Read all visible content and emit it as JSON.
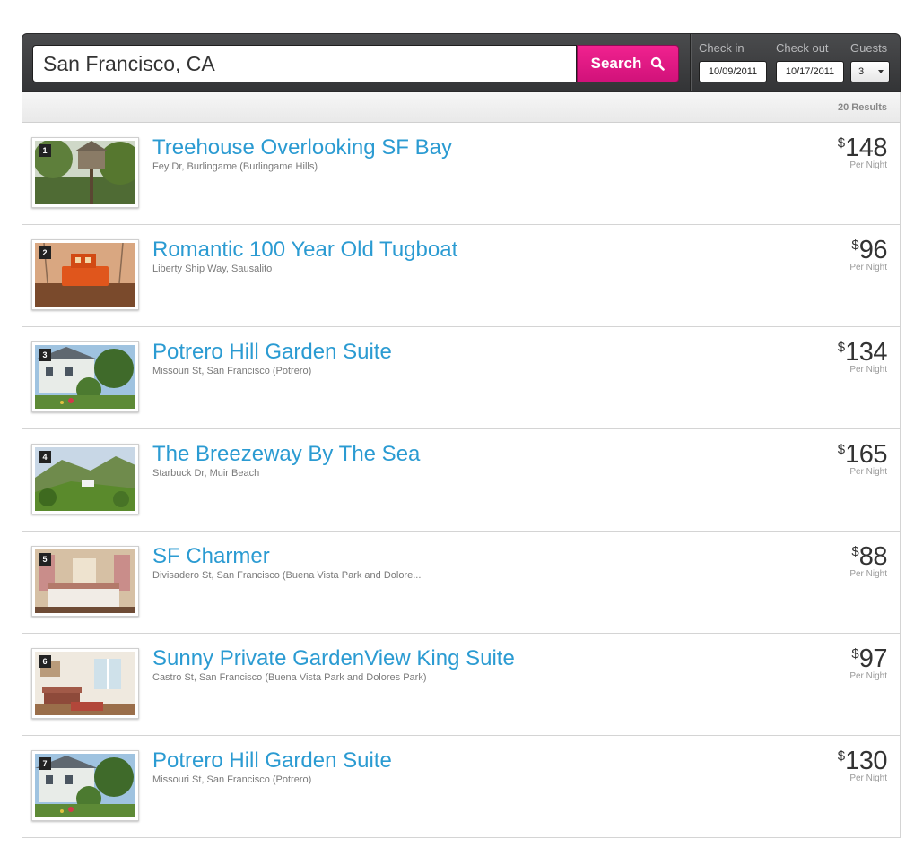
{
  "search": {
    "location_value": "San Francisco, CA",
    "button_label": "Search"
  },
  "dates": {
    "checkin_label": "Check in",
    "checkin_value": "10/09/2011",
    "checkout_label": "Check out",
    "checkout_value": "10/17/2011",
    "guests_label": "Guests",
    "guests_value": "3"
  },
  "results": {
    "count_text": "20 Results",
    "currency_symbol": "$",
    "per_night_label": "Per Night",
    "items": [
      {
        "number": "1",
        "title": "Treehouse Overlooking SF Bay",
        "address": "Fey Dr, Burlingame (Burlingame Hills)",
        "price": "148",
        "photo": "treehouse-photo"
      },
      {
        "number": "2",
        "title": "Romantic 100 Year Old Tugboat",
        "address": "Liberty Ship Way, Sausalito",
        "price": "96",
        "photo": "tugboat-photo"
      },
      {
        "number": "3",
        "title": "Potrero Hill Garden Suite",
        "address": "Missouri St, San Francisco (Potrero)",
        "price": "134",
        "photo": "garden-house-photo"
      },
      {
        "number": "4",
        "title": "The Breezeway By The Sea",
        "address": "Starbuck Dr, Muir Beach",
        "price": "165",
        "photo": "hillside-photo"
      },
      {
        "number": "5",
        "title": "SF Charmer",
        "address": "Divisadero St, San Francisco (Buena Vista Park and Dolore...",
        "price": "88",
        "photo": "bedroom-photo"
      },
      {
        "number": "6",
        "title": "Sunny Private GardenView King Suite",
        "address": "Castro St, San Francisco (Buena Vista Park and Dolores Park)",
        "price": "97",
        "photo": "living-room-photo"
      },
      {
        "number": "7",
        "title": "Potrero Hill Garden Suite",
        "address": "Missouri St, San Francisco (Potrero)",
        "price": "130",
        "photo": "garden-house-photo"
      }
    ]
  },
  "colors": {
    "accent_pink": "#e0197f",
    "link_blue": "#2b9bd2",
    "header_dark": "#3d3e40"
  }
}
